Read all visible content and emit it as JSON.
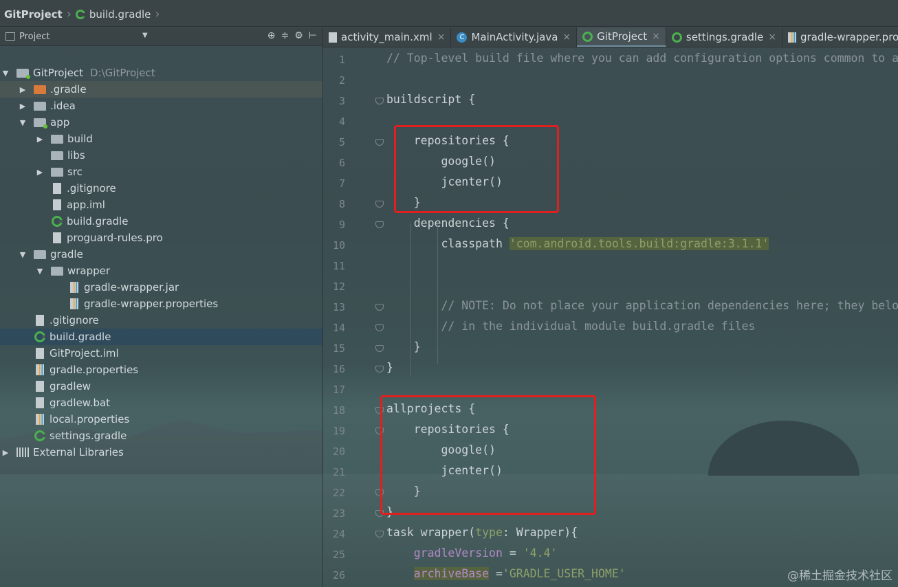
{
  "breadcrumb": {
    "project": "GitProject",
    "file": "build.gradle"
  },
  "project_pane": {
    "view_label": "Project",
    "tree": [
      {
        "label": "GitProject",
        "path": "D:\\GitProject",
        "icon": "module-folder-icon",
        "expanded": true,
        "depth": 0
      },
      {
        "label": ".gradle",
        "icon": "folder-icon",
        "expanded": false,
        "depth": 1
      },
      {
        "label": ".idea",
        "icon": "folder-icon",
        "expanded": false,
        "depth": 1
      },
      {
        "label": "app",
        "icon": "module-folder-icon",
        "expanded": true,
        "depth": 1
      },
      {
        "label": "build",
        "icon": "folder-icon",
        "expanded": false,
        "depth": 2
      },
      {
        "label": "libs",
        "icon": "folder-icon",
        "depth": 2
      },
      {
        "label": "src",
        "icon": "folder-icon",
        "expanded": false,
        "depth": 2
      },
      {
        "label": ".gitignore",
        "icon": "file-icon",
        "depth": 2
      },
      {
        "label": "app.iml",
        "icon": "file-icon",
        "depth": 2
      },
      {
        "label": "build.gradle",
        "icon": "gradle-icon",
        "depth": 2
      },
      {
        "label": "proguard-rules.pro",
        "icon": "file-icon",
        "depth": 2
      },
      {
        "label": "gradle",
        "icon": "folder-icon",
        "expanded": true,
        "depth": 1
      },
      {
        "label": "wrapper",
        "icon": "folder-icon",
        "expanded": true,
        "depth": 2
      },
      {
        "label": "gradle-wrapper.jar",
        "icon": "jar-icon",
        "depth": 3
      },
      {
        "label": "gradle-wrapper.properties",
        "icon": "properties-icon",
        "depth": 3
      },
      {
        "label": ".gitignore",
        "icon": "file-icon",
        "depth": 1
      },
      {
        "label": "build.gradle",
        "icon": "gradle-icon",
        "depth": 1,
        "selected": true
      },
      {
        "label": "GitProject.iml",
        "icon": "file-icon",
        "depth": 1
      },
      {
        "label": "gradle.properties",
        "icon": "properties-icon",
        "depth": 1
      },
      {
        "label": "gradlew",
        "icon": "file-icon",
        "depth": 1
      },
      {
        "label": "gradlew.bat",
        "icon": "file-icon",
        "depth": 1
      },
      {
        "label": "local.properties",
        "icon": "properties-icon",
        "depth": 1
      },
      {
        "label": "settings.gradle",
        "icon": "gradle-icon",
        "depth": 1
      },
      {
        "label": "External Libraries",
        "icon": "libraries-icon",
        "expanded": false,
        "depth": 0
      }
    ]
  },
  "tabs": [
    {
      "label": "activity_main.xml",
      "icon": "xml-icon"
    },
    {
      "label": "MainActivity.java",
      "icon": "class-icon"
    },
    {
      "label": "GitProject",
      "icon": "gradle-icon",
      "active": true
    },
    {
      "label": "settings.gradle",
      "icon": "gradle-icon"
    },
    {
      "label": "gradle-wrapper.pro",
      "icon": "properties-icon"
    }
  ],
  "code_lines": [
    {
      "n": "1",
      "text": "// Top-level build file where you can add configuration options common to a"
    },
    {
      "n": "2",
      "text": ""
    },
    {
      "n": "3",
      "text": "buildscript {"
    },
    {
      "n": "4",
      "text": ""
    },
    {
      "n": "5",
      "text": "    repositories {"
    },
    {
      "n": "6",
      "text": "        google()"
    },
    {
      "n": "7",
      "text": "        jcenter()"
    },
    {
      "n": "8",
      "text": "    }"
    },
    {
      "n": "9",
      "text": "    dependencies {"
    },
    {
      "n": "10",
      "text": "        classpath 'com.android.tools.build:gradle:3.1.1'"
    },
    {
      "n": "11",
      "text": ""
    },
    {
      "n": "12",
      "text": ""
    },
    {
      "n": "13",
      "text": "        // NOTE: Do not place your application dependencies here; they belo"
    },
    {
      "n": "14",
      "text": "        // in the individual module build.gradle files"
    },
    {
      "n": "15",
      "text": "    }"
    },
    {
      "n": "16",
      "text": "}"
    },
    {
      "n": "17",
      "text": ""
    },
    {
      "n": "18",
      "text": "allprojects {"
    },
    {
      "n": "19",
      "text": "    repositories {"
    },
    {
      "n": "20",
      "text": "        google()"
    },
    {
      "n": "21",
      "text": "        jcenter()"
    },
    {
      "n": "22",
      "text": "    }"
    },
    {
      "n": "23",
      "text": "}"
    },
    {
      "n": "24",
      "text": "task wrapper(type: Wrapper){"
    },
    {
      "n": "25",
      "text": "    gradleVersion = '4.4'"
    },
    {
      "n": "26",
      "text": "    archiveBase ='GRADLE_USER_HOME'"
    }
  ],
  "watermark": "@稀土掘金技术社区",
  "colors": {
    "highlight_box": "#e0201f",
    "selection": "#2f4a5a",
    "gradle_icon": "#4caf50"
  }
}
